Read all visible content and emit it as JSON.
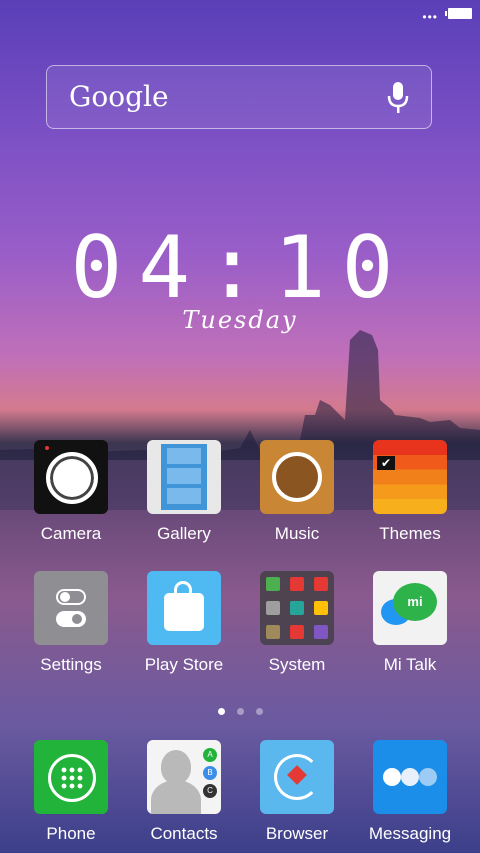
{
  "status": {
    "dots": "•••"
  },
  "search": {
    "label": "Google"
  },
  "clock": {
    "time": "04:10",
    "day": "Tuesday"
  },
  "apps_row1": [
    {
      "label": "Camera"
    },
    {
      "label": "Gallery"
    },
    {
      "label": "Music"
    },
    {
      "label": "Themes"
    }
  ],
  "apps_row2": [
    {
      "label": "Settings"
    },
    {
      "label": "Play Store"
    },
    {
      "label": "System"
    },
    {
      "label": "Mi Talk"
    }
  ],
  "dock": [
    {
      "label": "Phone"
    },
    {
      "label": "Contacts"
    },
    {
      "label": "Browser"
    },
    {
      "label": "Messaging"
    }
  ],
  "contacts_badges": [
    "A",
    "B",
    "C"
  ],
  "page_indicator": {
    "count": 3,
    "active": 0
  },
  "colors": {
    "phone_green": "#22b33a",
    "playstore_blue": "#4fb9f2",
    "browser_blue": "#5ab8ef",
    "messaging_blue": "#1a8ee8",
    "music_wood": "#c98735",
    "themes_red": "#e8341c"
  }
}
